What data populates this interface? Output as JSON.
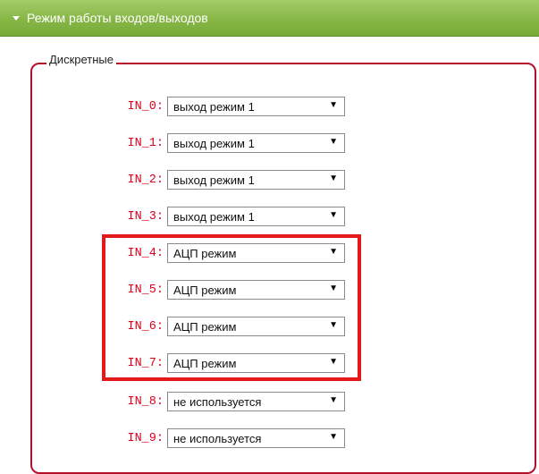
{
  "header": {
    "title": "Режим работы входов/выходов"
  },
  "group": {
    "legend": "Дискретные"
  },
  "inputs": [
    {
      "label": "IN_0:",
      "value": "выход режим 1"
    },
    {
      "label": "IN_1:",
      "value": "выход режим 1"
    },
    {
      "label": "IN_2:",
      "value": "выход режим 1"
    },
    {
      "label": "IN_3:",
      "value": "выход режим 1"
    },
    {
      "label": "IN_4:",
      "value": "АЦП режим"
    },
    {
      "label": "IN_5:",
      "value": "АЦП режим"
    },
    {
      "label": "IN_6:",
      "value": "АЦП режим"
    },
    {
      "label": "IN_7:",
      "value": "АЦП режим"
    },
    {
      "label": "IN_8:",
      "value": "не используется"
    },
    {
      "label": "IN_9:",
      "value": "не используется"
    }
  ],
  "colors": {
    "header": "#86b646",
    "label": "#d9001b",
    "frame": "#b3112a",
    "highlight": "#e3191c"
  },
  "icons": {
    "collapse": "triangle-down-icon",
    "dropdown": "dropdown-arrow-icon"
  }
}
